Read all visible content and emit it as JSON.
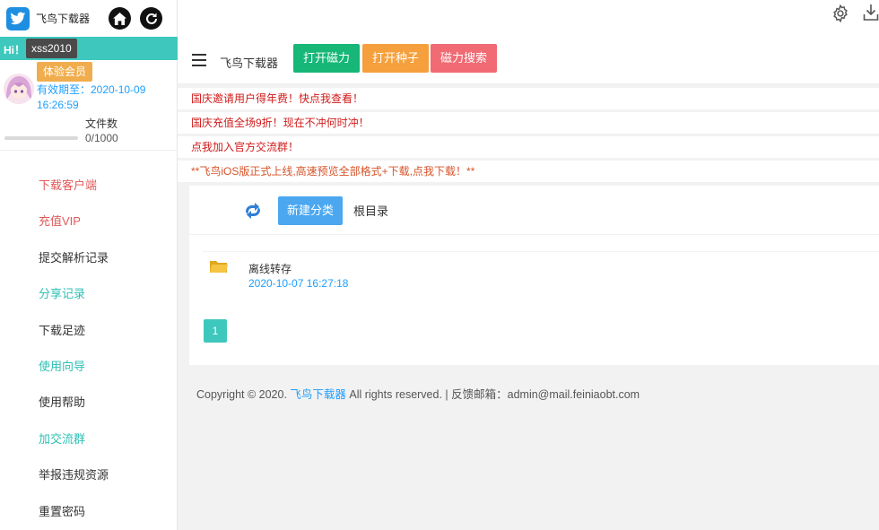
{
  "sidebar": {
    "brand_name": "飞鸟下载器",
    "hi": "Hi！",
    "username": "xss2010",
    "vip_badge": "体验会员",
    "expire_line1": "有效期至：2020-10-09",
    "expire_line2": "16:26:59",
    "files_label": "文件数",
    "files_count": "0/1000",
    "files_used_fraction": 0,
    "menu": [
      {
        "label": "下载客户端"
      },
      {
        "label": "充值VIP"
      },
      {
        "label": "提交解析记录"
      },
      {
        "label": "分享记录"
      },
      {
        "label": "下载足迹"
      },
      {
        "label": "使用向导"
      },
      {
        "label": "使用帮助"
      },
      {
        "label": "加交流群"
      },
      {
        "label": "举报违规资源"
      },
      {
        "label": "重置密码"
      }
    ]
  },
  "nav": {
    "title": "飞鸟下载器",
    "btn_magnet": "打开磁力",
    "btn_torrent": "打开种子",
    "btn_search": "磁力搜索"
  },
  "notices": [
    "国庆邀请用户得年费！快点我查看！",
    "国庆充值全场9折！现在不冲何时冲！",
    "点我加入官方交流群！",
    "**飞鸟iOS版正式上线,高速预览全部格式+下载,点我下载！**"
  ],
  "files": {
    "new_folder_button": "新建分类",
    "root_label": "根目录",
    "items": [
      {
        "name": "离线转存",
        "date": "2020-10-07 16:27:18"
      }
    ],
    "current_page": "1"
  },
  "footer": {
    "copyright": "Copyright © 2020.",
    "site_name": "飞鸟下载器",
    "rights": "All rights reserved. | 反馈邮箱：admin@mail.feiniaobt.com"
  },
  "colors": {
    "teal": "#3ec8bd",
    "green": "#16b777",
    "orange": "#f5a03c",
    "pink": "#f06b73",
    "blue": "#1e9fff"
  }
}
